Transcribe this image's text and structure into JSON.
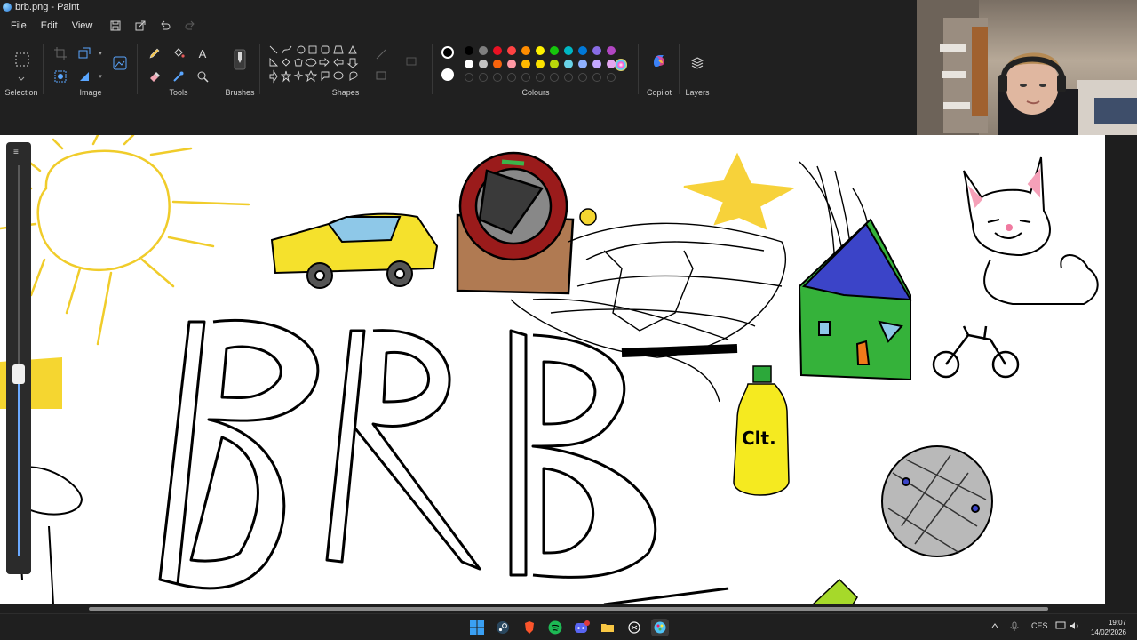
{
  "window": {
    "title": "brb.png - Paint"
  },
  "menu": {
    "file": "File",
    "edit": "Edit",
    "view": "View"
  },
  "ribbon": {
    "selection": "Selection",
    "image": "Image",
    "tools": "Tools",
    "brushes": "Brushes",
    "shapes": "Shapes",
    "colours": "Colours",
    "copilot": "Copilot",
    "layers": "Layers",
    "text_tool_glyph": "A"
  },
  "palette": {
    "row1": [
      "#000000",
      "#7f7f7f",
      "#e81123",
      "#ff4343",
      "#ff8c00",
      "#fff100",
      "#16c60c",
      "#00b7c3",
      "#0078d7",
      "#886ce4",
      "#b146c2"
    ],
    "row2": [
      "#ffffff",
      "#c3c3c3",
      "#f7630c",
      "#ff99a4",
      "#ffb900",
      "#fce100",
      "#bad80a",
      "#69d2e7",
      "#8fb1ff",
      "#c3a8ff",
      "#e3a6f0"
    ],
    "active_primary": "#000000",
    "active_secondary": "#ffffff"
  },
  "canvas": {
    "drawing_text": {
      "letters": "BRB",
      "bottle_label": "Clt."
    }
  },
  "taskbar": {
    "language": "CES",
    "time": "19:07",
    "date": "14/02/2026"
  }
}
